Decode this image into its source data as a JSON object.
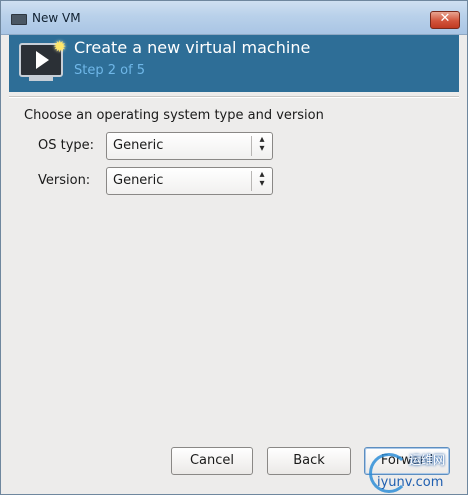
{
  "window": {
    "title": "New VM",
    "close_glyph": "✕"
  },
  "banner": {
    "title": "Create a new virtual machine",
    "step": "Step 2 of 5",
    "icon": "vm-monitor-play-icon",
    "badge_icon": "star-icon",
    "badge_glyph": "✹"
  },
  "form": {
    "heading": "Choose an operating system type and version",
    "os_type": {
      "label": "OS type:",
      "value": "Generic"
    },
    "version": {
      "label": "Version:",
      "value": "Generic"
    }
  },
  "buttons": {
    "cancel": "Cancel",
    "back": "Back",
    "forward": "Forward"
  },
  "watermark": {
    "brand": "运维网",
    "domain": "iyunv.com"
  },
  "colors": {
    "banner": "#2e6e97",
    "step_text": "#6fb7e8",
    "dialog_bg": "#edeceb"
  }
}
